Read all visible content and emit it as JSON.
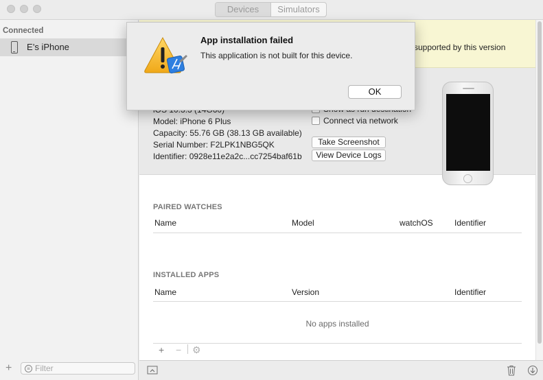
{
  "window": {
    "tabs": [
      {
        "label": "Devices",
        "active": true
      },
      {
        "label": "Simulators",
        "active": false
      }
    ]
  },
  "sidebar": {
    "section_header": "Connected",
    "devices": [
      {
        "label": "E’s iPhone",
        "selected": true
      }
    ],
    "filter_placeholder": "Filter",
    "add_icon": "plus-icon",
    "filter_icon": "filter-icon"
  },
  "banner": {
    "text": "supported by this version",
    "color": "#f8f6d3"
  },
  "device_info": {
    "os_version": "iOS 10.3.3 (14G60)",
    "model": "Model: iPhone 6 Plus",
    "capacity": "Capacity: 55.76 GB (38.13 GB available)",
    "serial": "Serial Number: F2LPK1NBG5QK",
    "identifier": "Identifier: 0928e11e2a2c...cc7254baf61b",
    "show_as_run_destination": "Show as run destination",
    "connect_via_network": "Connect via network",
    "take_screenshot": "Take Screenshot",
    "view_device_logs": "View Device Logs"
  },
  "paired_watches": {
    "title": "PAIRED WATCHES",
    "columns": [
      "Name",
      "Model",
      "watchOS",
      "Identifier"
    ]
  },
  "installed_apps": {
    "title": "INSTALLED APPS",
    "columns": [
      "Name",
      "Version",
      "Identifier"
    ],
    "empty_message": "No apps installed",
    "toolbar_icons": [
      "plus-icon",
      "minus-icon",
      "gear-icon"
    ]
  },
  "bottom_bar": {
    "icons": [
      "toggle-panel-icon",
      "trash-icon",
      "download-icon"
    ]
  },
  "alert": {
    "title": "App installation failed",
    "message": "This application is not built for this device.",
    "ok_label": "OK",
    "icon": "warning-icon",
    "accent": "#f3b21b"
  }
}
